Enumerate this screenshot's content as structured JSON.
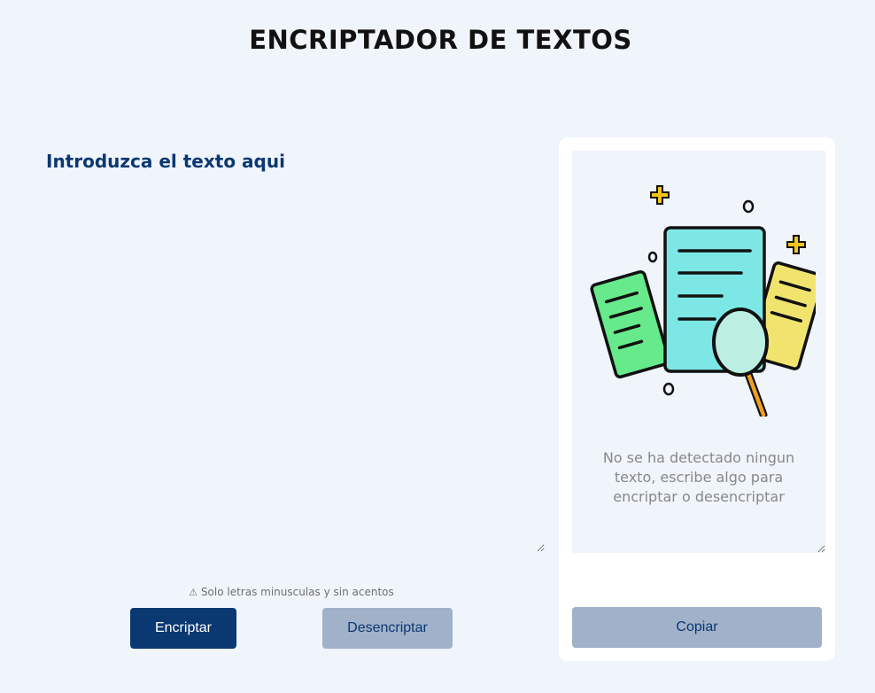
{
  "header": {
    "title": "ENCRIPTADOR DE TEXTOS"
  },
  "input": {
    "placeholder": "Introduzca el texto aqui",
    "value": ""
  },
  "warning": {
    "icon": "warning-icon",
    "text": "Solo letras minusculas y sin acentos"
  },
  "buttons": {
    "encrypt_label": "Encriptar",
    "decrypt_label": "Desencriptar",
    "copy_label": "Copiar"
  },
  "output": {
    "empty_message": "No se ha detectado ningun texto, escribe algo para encriptar o desencriptar",
    "illustration": "document-search-illustration"
  },
  "colors": {
    "background": "#f0f4fb",
    "primary": "#0a3871",
    "secondary_button": "#a0b1c9",
    "card": "#ffffff",
    "muted_text": "#888888"
  }
}
